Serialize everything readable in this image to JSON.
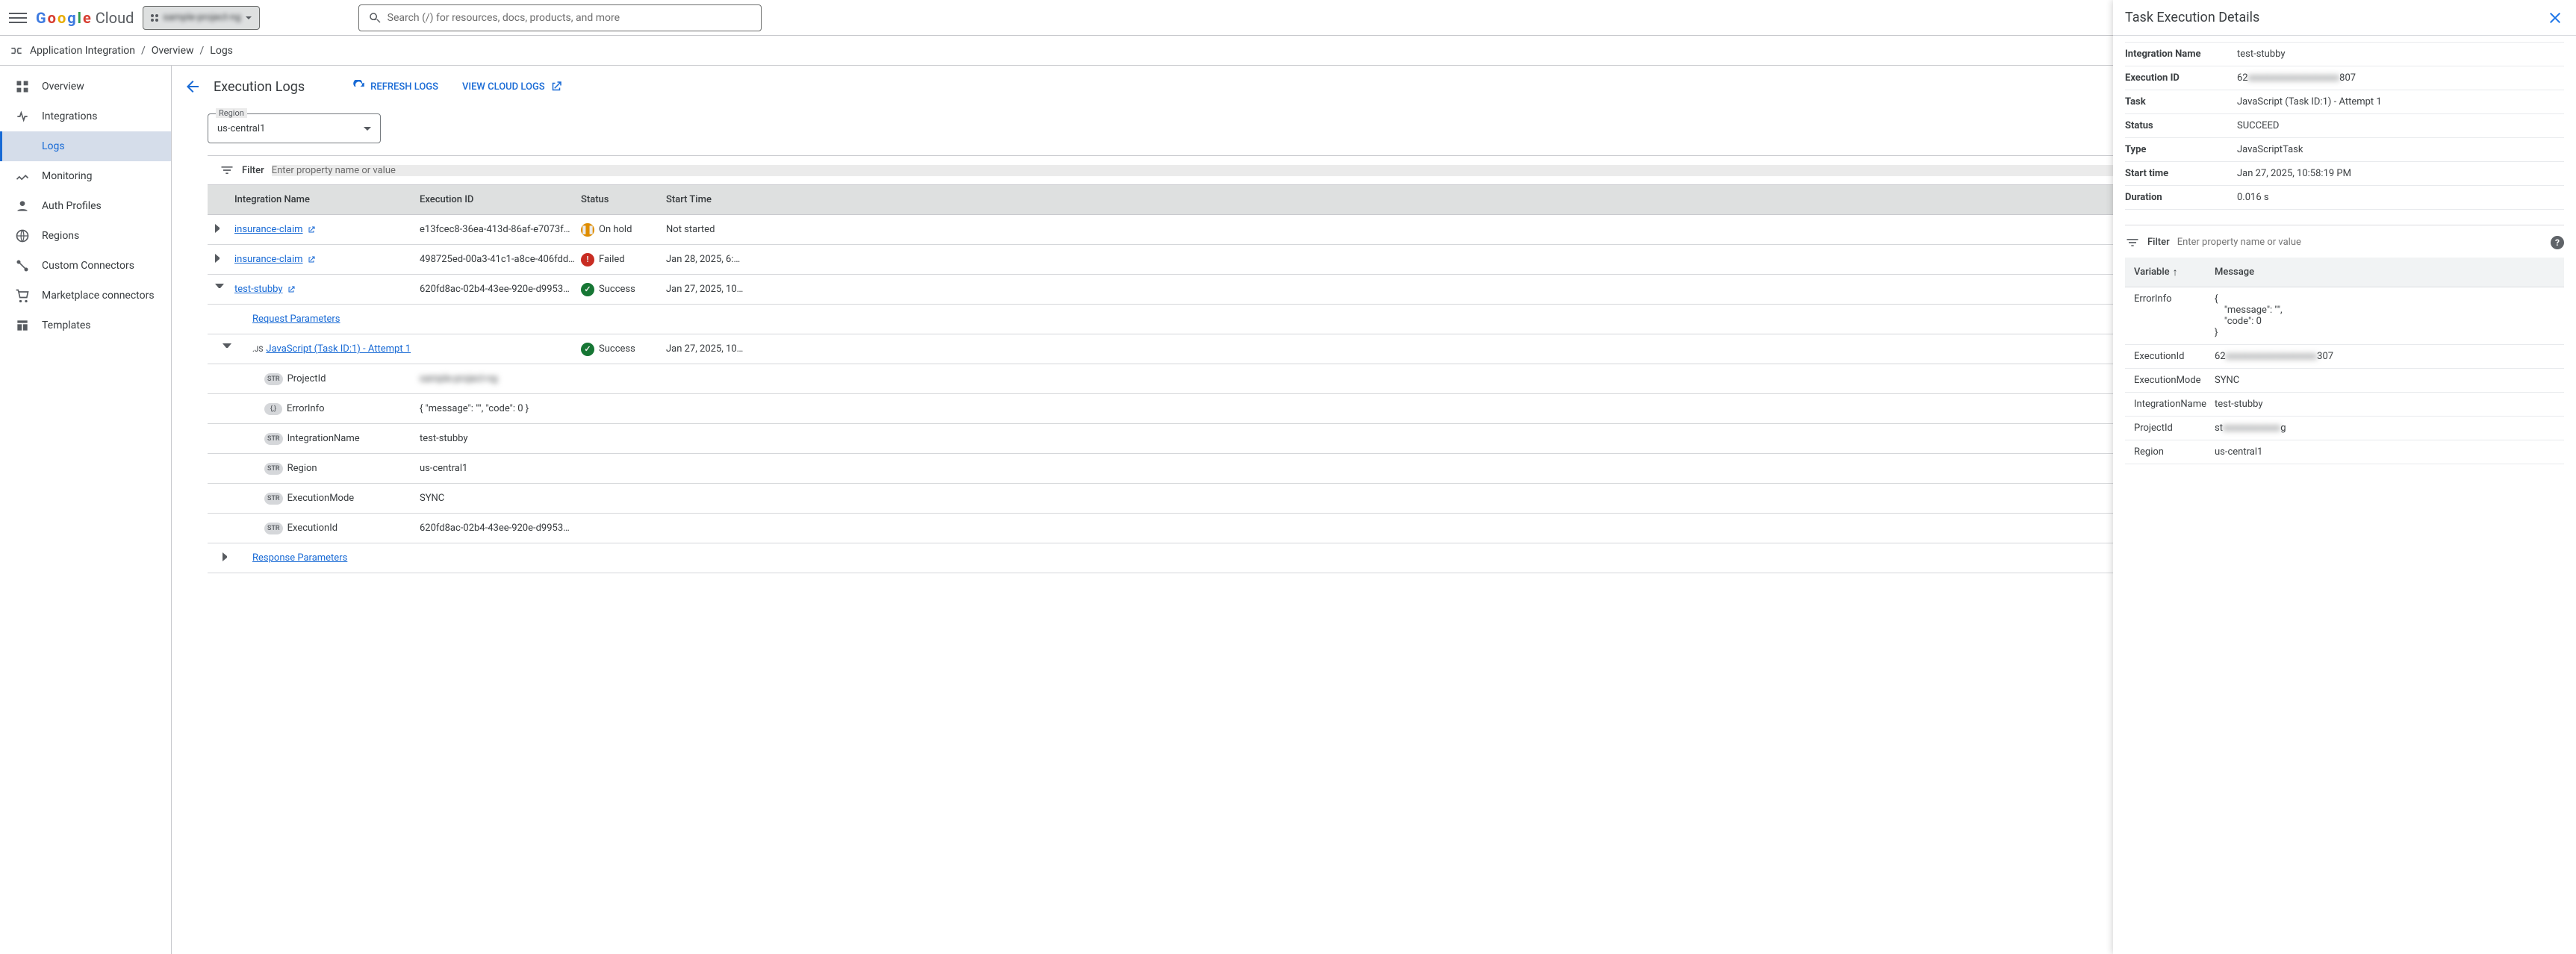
{
  "topbar": {
    "logo_cloud": "Cloud",
    "project_name": "sample-project-ng",
    "search_placeholder": "Search (/) for resources, docs, products, and more"
  },
  "breadcrumb": {
    "product": "Application Integration",
    "overview": "Overview",
    "logs": "Logs"
  },
  "sidebar": {
    "items": [
      {
        "label": "Overview"
      },
      {
        "label": "Integrations"
      },
      {
        "label": "Logs"
      },
      {
        "label": "Monitoring"
      },
      {
        "label": "Auth Profiles"
      },
      {
        "label": "Regions"
      },
      {
        "label": "Custom Connectors"
      },
      {
        "label": "Marketplace connectors"
      },
      {
        "label": "Templates"
      }
    ]
  },
  "page": {
    "title": "Execution Logs",
    "refresh_btn": "REFRESH LOGS",
    "view_cloud_btn": "VIEW CLOUD LOGS",
    "region_label": "Region",
    "region_value": "us-central1",
    "filter_label": "Filter",
    "filter_placeholder": "Enter property name or value",
    "columns": {
      "integration": "Integration Name",
      "execution": "Execution ID",
      "status": "Status",
      "start": "Start Time"
    },
    "rows": [
      {
        "name": "insurance-claim",
        "exec": "e13fcec8-36ea-413d-86af-e7073f…",
        "status": "On hold",
        "statusType": "hold",
        "start": "Not started",
        "level": 0,
        "link": true,
        "expander": "right"
      },
      {
        "name": "insurance-claim",
        "exec": "498725ed-00a3-41c1-a8ce-406fdd…",
        "status": "Failed",
        "statusType": "fail",
        "start": "Jan 28, 2025, 6:…",
        "level": 0,
        "link": true,
        "expander": "right"
      },
      {
        "name": "test-stubby",
        "exec": "620fd8ac-02b4-43ee-920e-d9953…",
        "status": "Success",
        "statusType": "ok",
        "start": "Jan 27, 2025, 10…",
        "level": 0,
        "link": true,
        "expander": "down"
      }
    ],
    "request_params_label": "Request Parameters",
    "js_task_label": "JavaScript (Task ID:1) - Attempt 1",
    "js_task_prefix": ".JS",
    "js_task_status": "Success",
    "js_task_start": "Jan 27, 2025, 10…",
    "vars": [
      {
        "badge": "STR",
        "name": "ProjectId",
        "value": "sample-project-ng",
        "blur": true
      },
      {
        "badge": "{,}",
        "name": "ErrorInfo",
        "value": "{ \"message\": \"\", \"code\": 0 }"
      },
      {
        "badge": "STR",
        "name": "IntegrationName",
        "value": "test-stubby"
      },
      {
        "badge": "STR",
        "name": "Region",
        "value": "us-central1"
      },
      {
        "badge": "STR",
        "name": "ExecutionMode",
        "value": "SYNC"
      },
      {
        "badge": "STR",
        "name": "ExecutionId",
        "value": "620fd8ac-02b4-43ee-920e-d9953…"
      }
    ],
    "response_params_label": "Response Parameters"
  },
  "panel": {
    "title": "Task Execution Details",
    "kv": [
      {
        "k": "Integration Name",
        "v": "test-stubby"
      },
      {
        "k": "Execution ID",
        "v": "62████████████████████807",
        "blur": true,
        "raw": "62                                           807"
      },
      {
        "k": "Task",
        "v": "JavaScript (Task ID:1) - Attempt 1"
      },
      {
        "k": "Status",
        "v": "SUCCEED"
      },
      {
        "k": "Type",
        "v": "JavaScriptTask"
      },
      {
        "k": "Start time",
        "v": "Jan 27, 2025, 10:58:19 PM"
      },
      {
        "k": "Duration",
        "v": "0.016 s"
      }
    ],
    "filter_label": "Filter",
    "filter_placeholder": "Enter property name or value",
    "col_var": "Variable",
    "col_msg": "Message",
    "vars": [
      {
        "name": "ErrorInfo",
        "msg": "{\n    \"message\": \"\",\n    \"code\": 0\n}"
      },
      {
        "name": "ExecutionId",
        "msg": "62████████████████████307",
        "blur": true
      },
      {
        "name": "ExecutionMode",
        "msg": "SYNC"
      },
      {
        "name": "IntegrationName",
        "msg": "test-stubby"
      },
      {
        "name": "ProjectId",
        "msg": "st██████████████g",
        "blur": true
      },
      {
        "name": "Region",
        "msg": "us-central1"
      }
    ]
  }
}
